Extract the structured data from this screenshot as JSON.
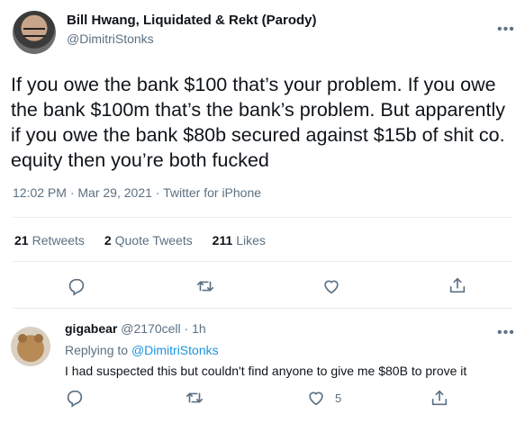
{
  "tweet": {
    "author_name": "Bill Hwang, Liquidated & Rekt (Parody)",
    "author_handle": "@DimitriStonks",
    "more_icon": "more-horizontal-icon",
    "text": "If you owe the bank $100 that’s your problem. If you owe the bank $100m that’s the bank’s problem. But apparently if you owe the bank $80b secured against $15b of shit co. equity then you’re both fucked",
    "time": "12:02 PM",
    "sep": "·",
    "date": "Mar 29, 2021",
    "source": "Twitter for iPhone",
    "stats": {
      "retweets_count": "21",
      "retweets_label": "Retweets",
      "quotes_count": "2",
      "quotes_label": "Quote Tweets",
      "likes_count": "211",
      "likes_label": "Likes"
    },
    "actions": [
      "reply-icon",
      "retweet-icon",
      "like-icon",
      "share-icon"
    ]
  },
  "reply": {
    "name": "gigabear",
    "handle": "@2170cell",
    "sep": "·",
    "time": "1h",
    "replying_prefix": "Replying to",
    "replying_handle": "@DimitriStonks",
    "text": "I had suspected this but couldn't find anyone to give me $80B to prove it",
    "like_count": "5",
    "actions": [
      "reply-icon",
      "retweet-icon",
      "like-icon",
      "share-icon"
    ]
  },
  "colors": {
    "text": "#0f1419",
    "secondary": "#5b7083",
    "link": "#1b95e0",
    "divider": "#e6ecf0"
  }
}
